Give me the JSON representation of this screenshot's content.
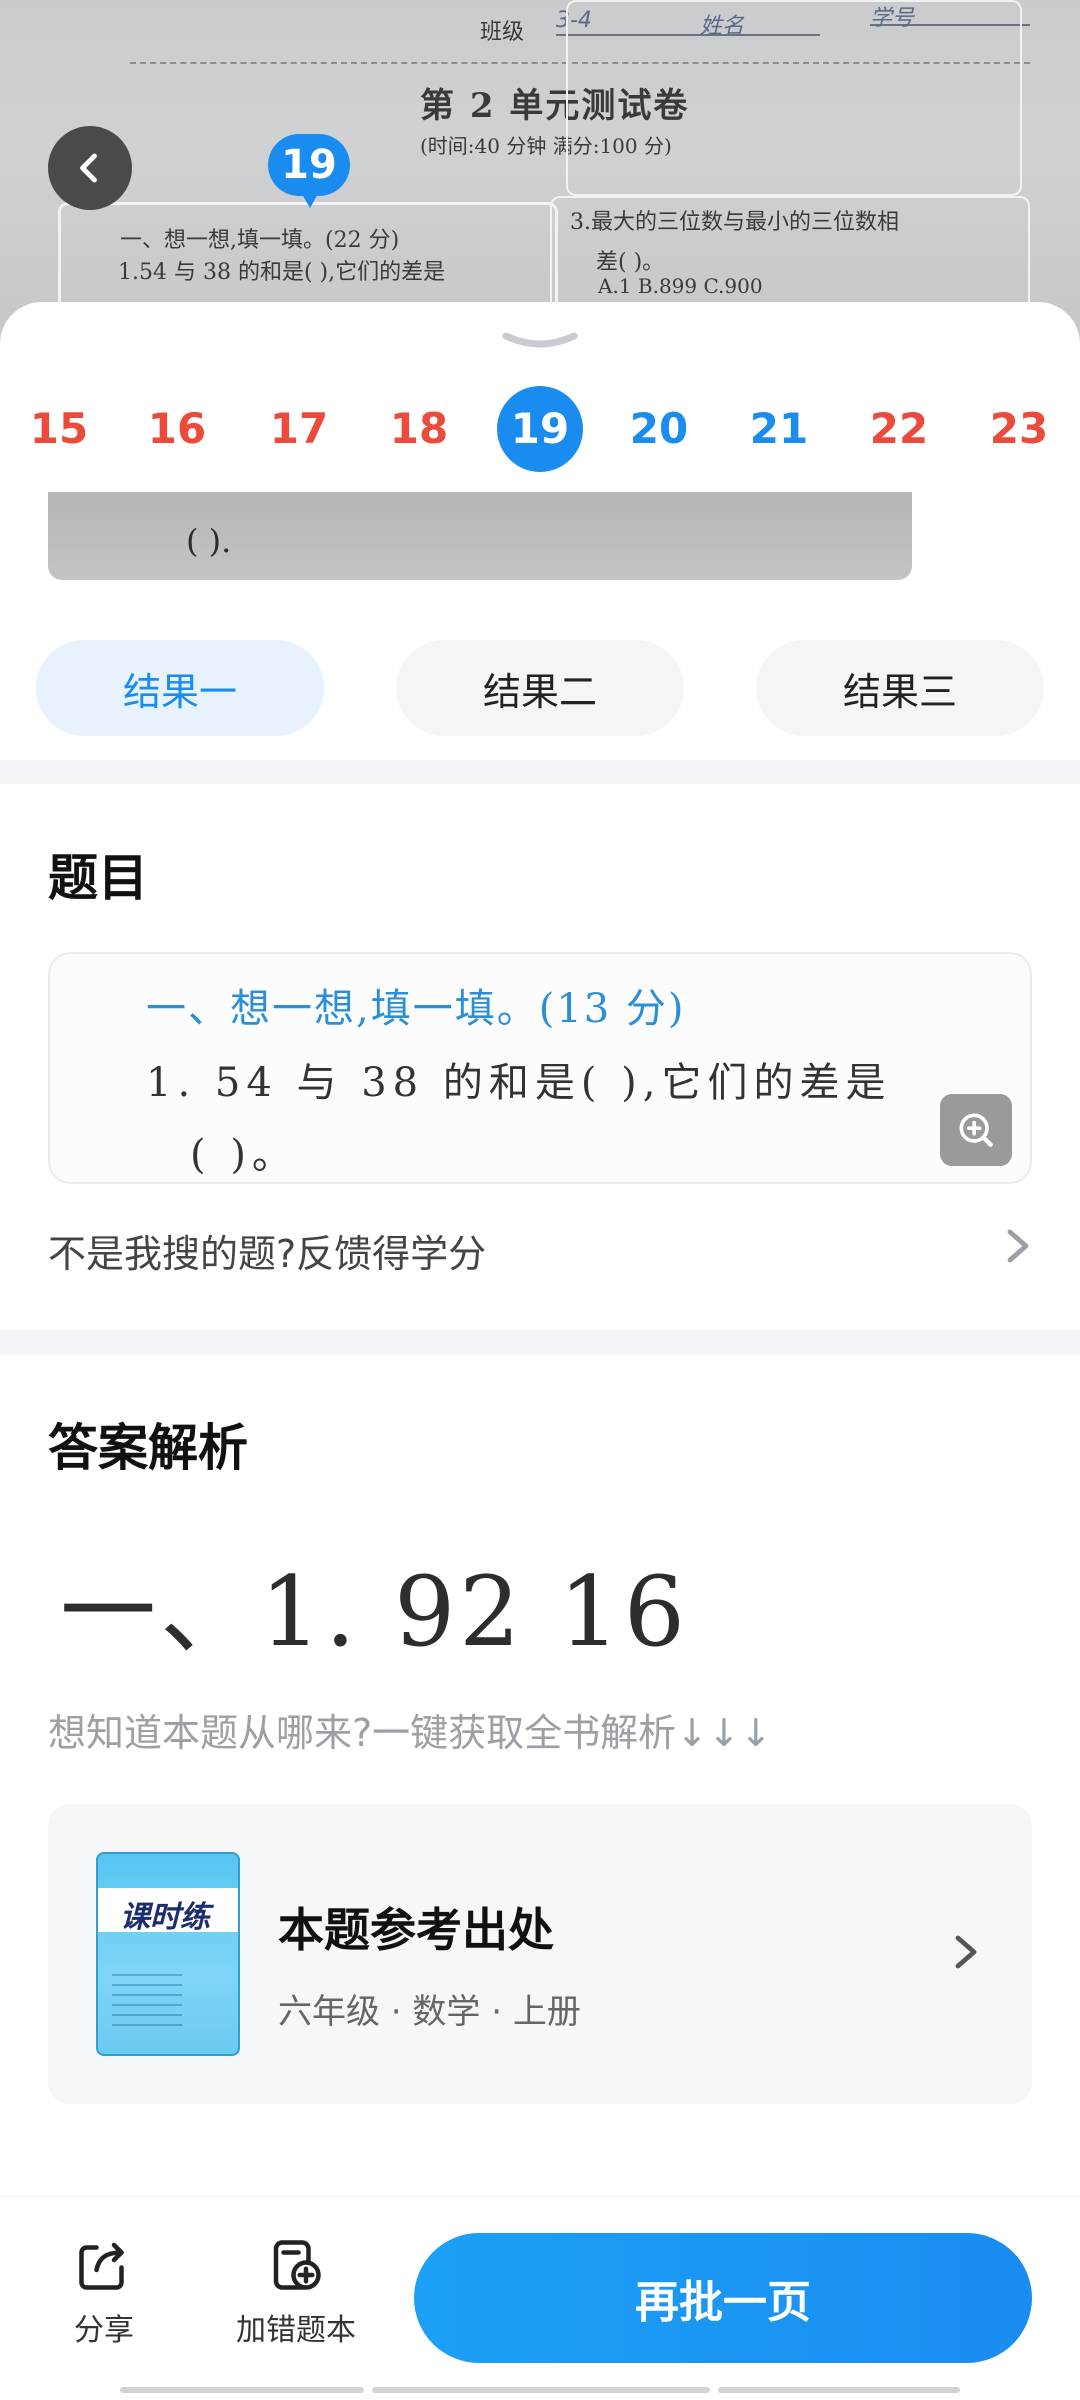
{
  "photo": {
    "header": "班级",
    "header_fields": [
      "3-4",
      "姓名",
      "学号"
    ],
    "exam_title": "第 2 单元测试卷",
    "exam_sub": "(时间:40 分钟   满分:100 分)",
    "q_section": "一、想一想,填一填。(22 分)",
    "q1": "1.54 与 38 的和是(     ),它们的差是",
    "q3": "3.最大的三位数与最小的三位数相",
    "q3b": "差(     )。",
    "q3c": "A.1         B.899        C.900"
  },
  "marker_number": "19",
  "question_numbers": [
    {
      "label": "15",
      "status": "wrong"
    },
    {
      "label": "16",
      "status": "wrong"
    },
    {
      "label": "17",
      "status": "wrong"
    },
    {
      "label": "18",
      "status": "wrong"
    },
    {
      "label": "19",
      "status": "active"
    },
    {
      "label": "20",
      "status": "right"
    },
    {
      "label": "21",
      "status": "right"
    },
    {
      "label": "22",
      "status": "wrong"
    },
    {
      "label": "23",
      "status": "wrong"
    }
  ],
  "crop_text": "(     ).",
  "result_tabs": [
    "结果一",
    "结果二",
    "结果三"
  ],
  "section_question": "题目",
  "question_card": {
    "line1": "一、想一想,填一填。(13 分)",
    "line2": "1. 54 与 38 的和是(      ),它们的差是",
    "line3": "(      )。"
  },
  "feedback_text": "不是我搜的题?反馈得学分",
  "section_answer": "答案解析",
  "answer_text": "一、1. 92   16",
  "hint_text": "想知道本题从哪来?一键获取全书解析↓↓↓",
  "source": {
    "title": "本题参考出处",
    "meta": "六年级 · 数学 · 上册",
    "cover_title": "课时练"
  },
  "bottom": {
    "share": "分享",
    "add_wrong": "加错题本",
    "primary": "再批一页"
  },
  "colors": {
    "accent_blue": "#1a8cf0",
    "wrong_red": "#ea4b3a",
    "tab_active_bg": "#e7f2fe"
  }
}
